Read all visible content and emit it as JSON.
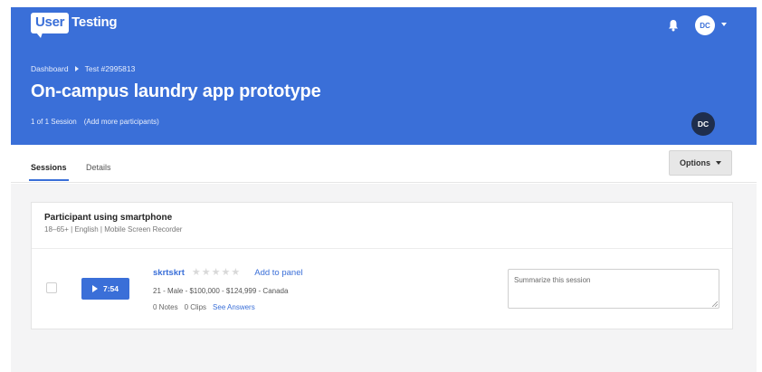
{
  "header": {
    "logo_primary": "User",
    "logo_secondary": "Testing",
    "user_initials": "DC",
    "breadcrumb": [
      "Dashboard",
      "Test #2995813"
    ],
    "title": "On-campus laundry app prototype",
    "session_count": "1 of 1 Session",
    "add_participants": "(Add more participants)",
    "owner_initials": "DC",
    "icons": [
      "bell-icon",
      "caret-down-icon"
    ]
  },
  "tabs": [
    {
      "label": "Sessions",
      "active": true
    },
    {
      "label": "Details",
      "active": false
    }
  ],
  "options": {
    "label": "Options"
  },
  "card": {
    "title": "Participant using smartphone",
    "subtitle": "18–65+ | English | Mobile Screen Recorder",
    "row": {
      "play_label": "7:54",
      "participant": "skrtskrt",
      "rating": 0,
      "rating_max": 5,
      "add_to_panel": "Add to panel",
      "demographics": "21 - Male - $100,000 - $124,999 - Canada",
      "notes": "0 Notes",
      "clips": "0 Clips",
      "see_answers": "See Answers",
      "summary_placeholder": "Summarize this session"
    }
  },
  "colors": {
    "brand_blue": "#3a6fd8",
    "avatar_dark": "#1f2e4d",
    "page_bg": "#f4f4f5"
  }
}
